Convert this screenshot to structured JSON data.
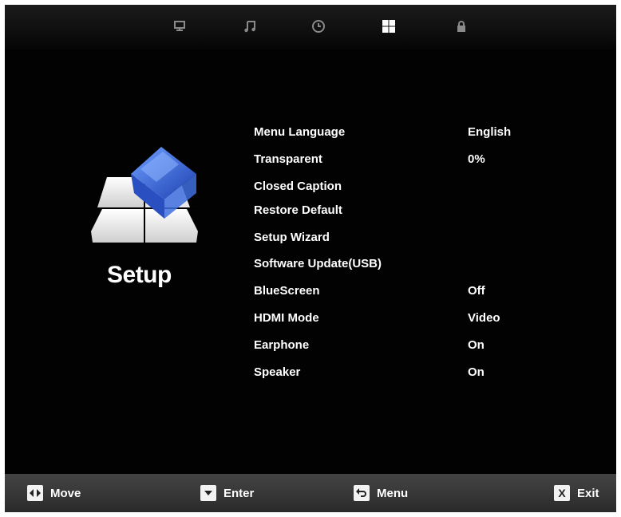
{
  "top_tabs": [
    {
      "icon": "monitor-icon",
      "name": "picture"
    },
    {
      "icon": "music-note-icon",
      "name": "sound"
    },
    {
      "icon": "clock-icon",
      "name": "time"
    },
    {
      "icon": "setup-grid-icon",
      "name": "setup",
      "active": true
    },
    {
      "icon": "lock-icon",
      "name": "lock"
    }
  ],
  "section": {
    "title": "Setup",
    "icon": "setup-cube-icon"
  },
  "menu": {
    "items": [
      {
        "label": "Menu Language",
        "value": "English"
      },
      {
        "label": "Transparent",
        "value": "0%"
      },
      {
        "label": "Closed Caption",
        "value": ""
      },
      {
        "label": "Restore Default",
        "value": ""
      },
      {
        "label": "Setup Wizard",
        "value": ""
      },
      {
        "label": "Software Update(USB)",
        "value": ""
      },
      {
        "label": "BlueScreen",
        "value": "Off"
      },
      {
        "label": "HDMI Mode",
        "value": "Video"
      },
      {
        "label": "Earphone",
        "value": "On"
      },
      {
        "label": "Speaker",
        "value": "On"
      }
    ]
  },
  "bottom_bar": {
    "move": {
      "label": "Move",
      "icon": "left-right-arrows-icon"
    },
    "enter": {
      "label": "Enter",
      "icon": "down-arrow-icon"
    },
    "menu": {
      "label": "Menu",
      "icon": "return-arrow-icon"
    },
    "exit": {
      "label": "Exit",
      "icon": "x-key-icon",
      "key": "X"
    }
  },
  "colors": {
    "background": "#020202",
    "text": "#ffffff",
    "active_tab": "#ffffff",
    "inactive_tab": "#8a8a8a",
    "accent_blue": "#2f5fd0"
  }
}
